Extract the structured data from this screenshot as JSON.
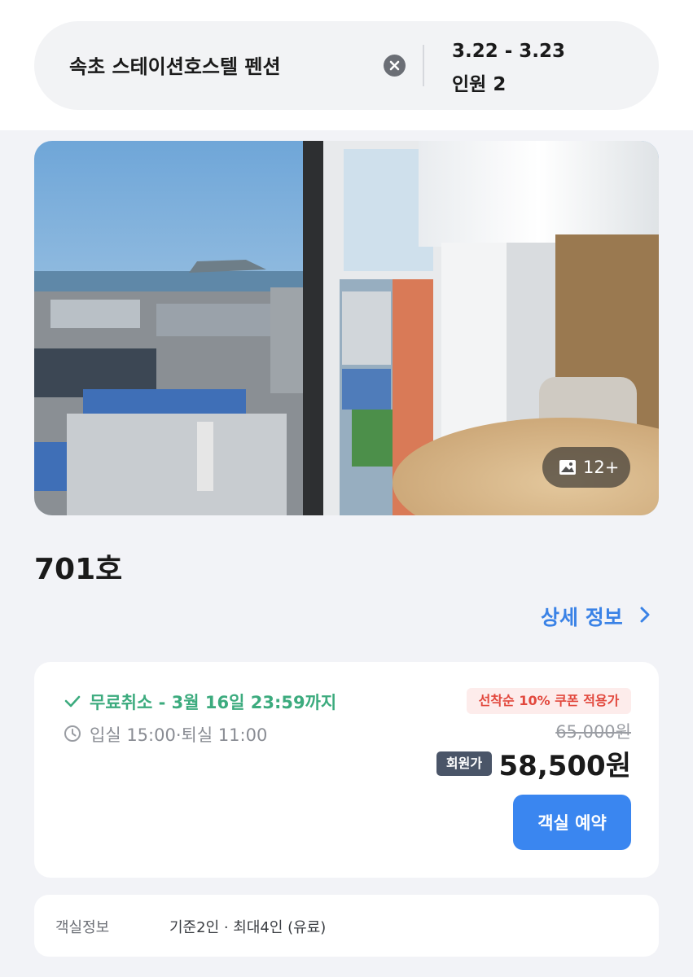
{
  "search": {
    "query": "속초 스테이션호스텔 펜션",
    "dates": "3.22 - 3.23",
    "guests": "인원 2"
  },
  "gallery": {
    "photo_count": "12+"
  },
  "room": {
    "name": "701호",
    "detail_link": "상세 정보"
  },
  "rate": {
    "free_cancel": "무료취소 - 3월 16일 23:59까지",
    "checkin_checkout": "입실 15:00·퇴실 11:00",
    "coupon_badge": "선착순 10% 쿠폰 적용가",
    "original_price": "65,000원",
    "member_label": "회원가",
    "member_price": "58,500원",
    "book_button": "객실 예약"
  },
  "room_info": {
    "label": "객실정보",
    "value": "기준2인 · 최대4인 (유료)"
  },
  "colors": {
    "accent_blue": "#3a86f0",
    "success_green": "#3cab7e",
    "coupon_red": "#e2483d"
  }
}
